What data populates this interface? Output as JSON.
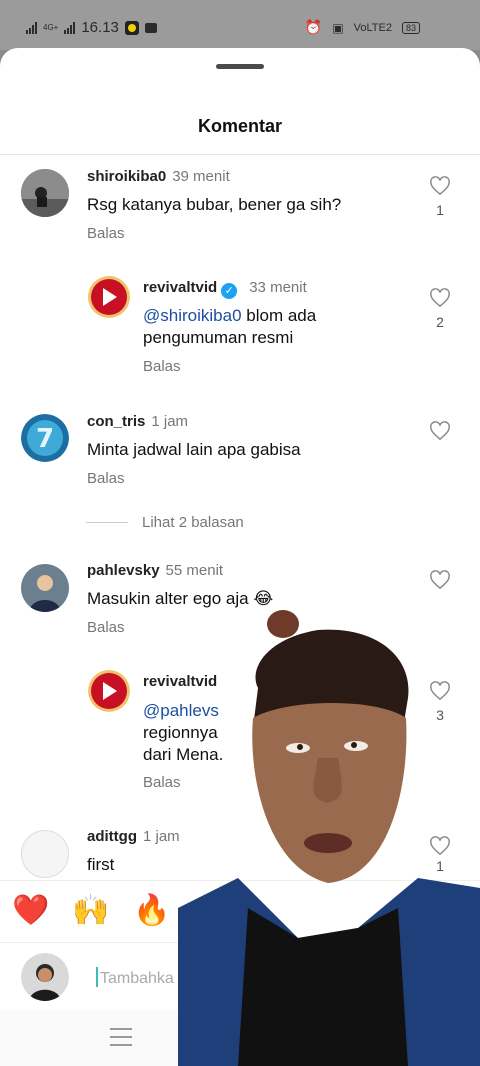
{
  "status": {
    "time": "16.13",
    "network": "4G+",
    "volte": "VoLTE2",
    "battery": "83"
  },
  "sheet": {
    "title": "Komentar"
  },
  "comments": [
    {
      "username": "shiroikiba0",
      "time": "39 menit",
      "text": "Rsg katanya bubar, bener ga sih?",
      "reply": "Balas",
      "likes": "1"
    },
    {
      "username": "revivaltvid",
      "time": "33 menit",
      "mention": "@shiroikiba0",
      "text": " blom ada pengumuman resmi",
      "reply": "Balas",
      "likes": "2"
    },
    {
      "username": "con_tris",
      "time": "1 jam",
      "text": "Minta jadwal lain apa gabisa",
      "reply": "Balas",
      "likes": ""
    },
    {
      "username": "pahlevsky",
      "time": "55 menit",
      "text": "Masukin alter ego aja 😂",
      "reply": "Balas",
      "likes": ""
    },
    {
      "username": "revivaltvid",
      "time": "",
      "mention": "@pahlevs",
      "text_line2": "regionnya",
      "text_line3": "dari Mena.",
      "reply": "Balas",
      "likes": "3"
    },
    {
      "username": "adittgg",
      "time": "1 jam",
      "text": "first",
      "likes": "1"
    }
  ],
  "more_replies": "Lihat 2 balasan",
  "reactions": [
    "❤️",
    "🙌",
    "🔥"
  ],
  "input": {
    "placeholder": "Tambahka"
  },
  "colors": {
    "accent": "#1d4f9e",
    "verified": "#1da1f2",
    "brand_red": "#d0112b"
  }
}
